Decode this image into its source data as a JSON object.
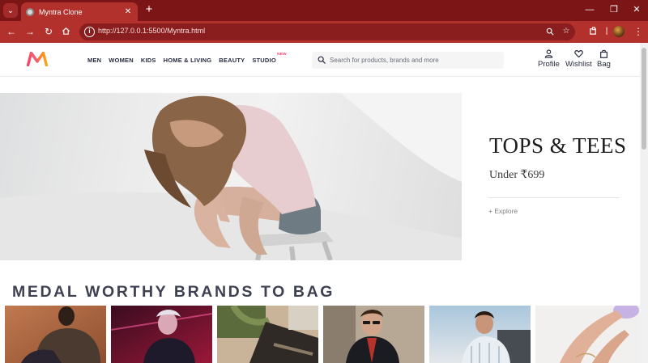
{
  "browser": {
    "tab_title": "Myntra Clone",
    "url": "http://127.0.0.1:5500/Myntra.html"
  },
  "header": {
    "nav": [
      {
        "label": "MEN"
      },
      {
        "label": "WOMEN"
      },
      {
        "label": "KIDS"
      },
      {
        "label": "HOME & LIVING"
      },
      {
        "label": "BEAUTY"
      },
      {
        "label": "STUDIO",
        "badge": "NEW"
      }
    ],
    "search_placeholder": "Search for products, brands and more",
    "actions": [
      {
        "label": "Profile",
        "icon": "profile-icon"
      },
      {
        "label": "Wishlist",
        "icon": "heart-icon"
      },
      {
        "label": "Bag",
        "icon": "bag-icon"
      }
    ]
  },
  "hero": {
    "title": "TOPS & TEES",
    "subtitle": "Under ₹699",
    "cta": "+ Explore"
  },
  "brands": {
    "title": "MEDAL WORTHY BRANDS TO BAG"
  },
  "colors": {
    "browser_frame": "#b3312c",
    "brand_pink": "#ff3f6c",
    "text_dark": "#282c3f"
  }
}
